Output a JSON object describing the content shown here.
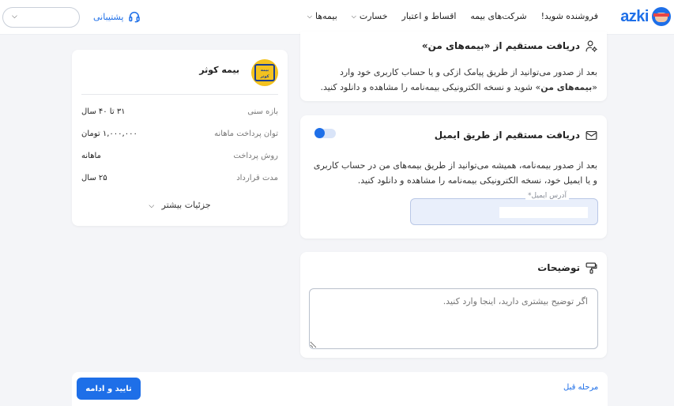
{
  "header": {
    "brand": "azki",
    "nav": [
      {
        "label": "بیمه‌ها",
        "has_dropdown": true
      },
      {
        "label": "خسارت",
        "has_dropdown": true
      },
      {
        "label": "اقساط و اعتبار",
        "has_dropdown": false
      },
      {
        "label": "شرکت‌های بیمه",
        "has_dropdown": false
      },
      {
        "label": "فروشنده شوید!",
        "has_dropdown": false
      }
    ],
    "support_label": "پشتیبانی",
    "select_value": ""
  },
  "summary": {
    "insurer_name": "بیمه کوثر",
    "insurer_logo_text": "بیمه کوثر",
    "rows": [
      {
        "key": "بازه سنی",
        "value": "۳۱ تا ۴۰ سال"
      },
      {
        "key": "توان پرداخت ماهانه",
        "value": "۱,۰۰۰,۰۰۰ تومان"
      },
      {
        "key": "روش پرداخت",
        "value": "ماهانه"
      },
      {
        "key": "مدت قرارداد",
        "value": "۲۵ سال"
      }
    ],
    "more_label": "جزئیات بیشتر"
  },
  "my_insurance": {
    "title": "دریافت مستقیم از «بیمه‌های من»",
    "body_pre": "بعد از صدور می‌توانید از طریق پیامک ازکی و یا حساب کاربری خود وارد «",
    "body_bold": "بیمه‌های من",
    "body_post": "» شوید و نسخه الکترونیکی بیمه‌نامه را مشاهده و دانلود کنید."
  },
  "email_delivery": {
    "title": "دریافت مستقیم از طریق ایمیل",
    "toggle_on": true,
    "body": "بعد از صدور بیمه‌نامه، همیشه می‌توانید از طریق بیمه‌های من در حساب کاربری و یا ایمیل خود، نسخه الکترونیکی بیمه‌نامه را مشاهده و دانلود کنید.",
    "email_label": "آدرس ایمیل*",
    "email_value": ""
  },
  "notes": {
    "title": "توضیحات",
    "placeholder": "اگر توضیح بیشتری دارید، اینجا وارد کنید."
  },
  "footer": {
    "confirm_label": "تایید و ادامه",
    "back_label": "مرحله قبل"
  },
  "colors": {
    "accent": "#1e6fe8",
    "page_bg": "#f4f5f8",
    "insurer_logo_bg": "#f3c21f"
  }
}
